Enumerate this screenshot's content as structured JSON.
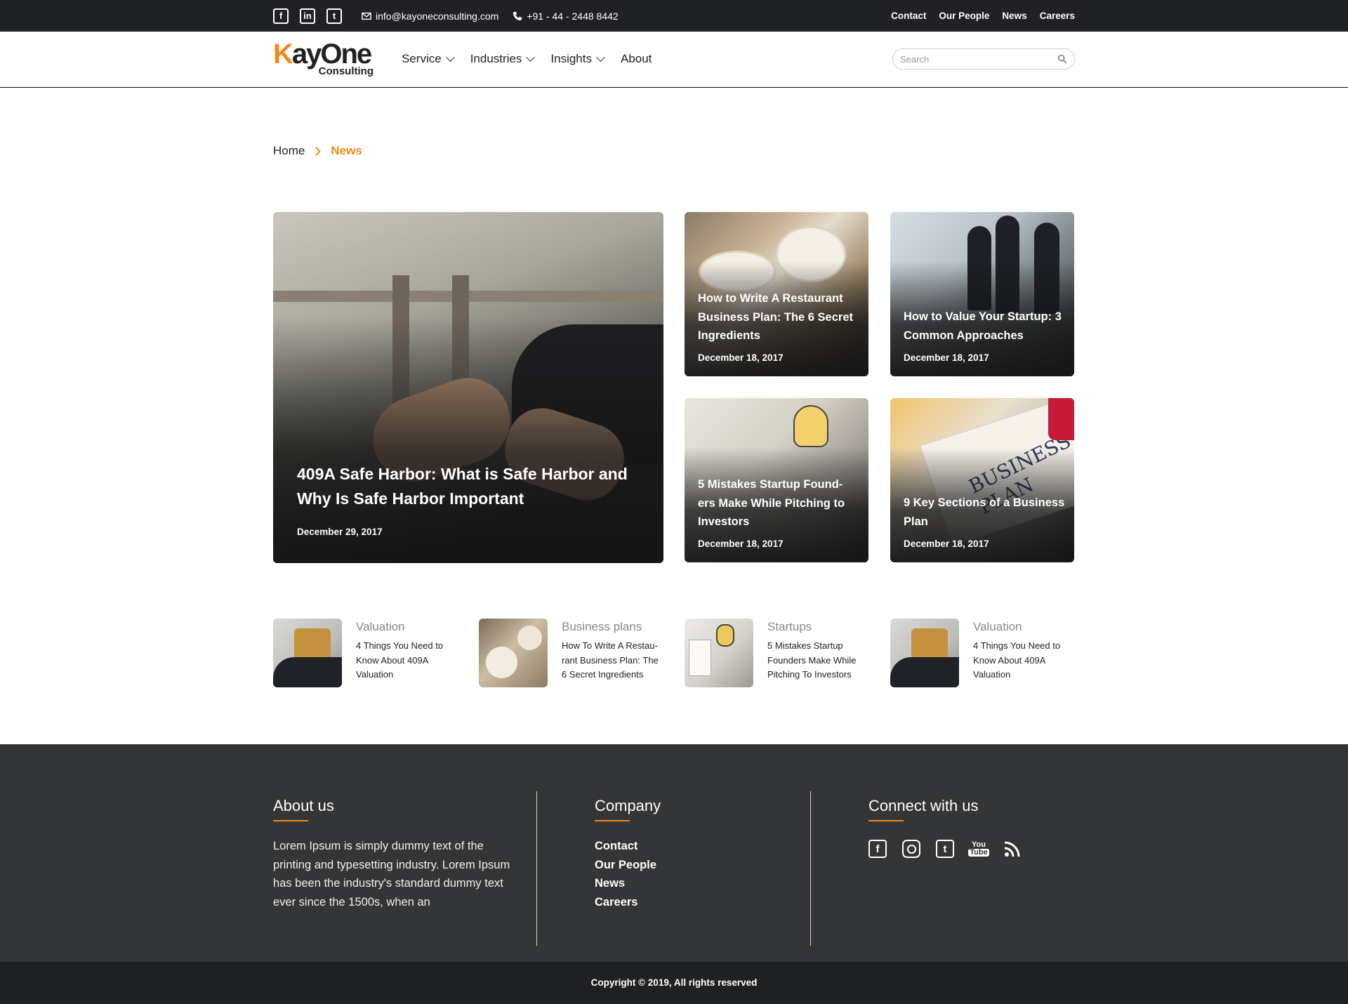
{
  "topbar": {
    "social": [
      {
        "icon": "facebook-icon",
        "glyph": "f"
      },
      {
        "icon": "linkedin-icon",
        "glyph": "in"
      },
      {
        "icon": "twitter-icon",
        "glyph": "t"
      }
    ],
    "email": "info@kayoneconsulting.com",
    "phone": "+91 - 44 - 2448 8442",
    "links": [
      "Contact",
      "Our People",
      "News",
      "Careers"
    ]
  },
  "header": {
    "logo_main": "KayOne",
    "logo_sub": "Consulting",
    "nav": [
      {
        "label": "Service",
        "dropdown": true
      },
      {
        "label": "Industries",
        "dropdown": true
      },
      {
        "label": "Insights",
        "dropdown": true
      },
      {
        "label": "About",
        "dropdown": false
      }
    ],
    "search_placeholder": "Search"
  },
  "breadcrumb": {
    "home": "Home",
    "current": "News"
  },
  "featured": {
    "title": "409A Safe Harbor: What is Safe Harbor and Why Is Safe Harbor Important",
    "date": "December 29, 2017"
  },
  "cards": [
    {
      "title": "How to Write A Restaurant Business Plan: The 6 Secret Ingredients",
      "date": "December 18, 2017"
    },
    {
      "title": "How to Value Your Startup: 3 Common Approaches",
      "date": "December 18, 2017"
    },
    {
      "title": "5 Mistakes Startup Found-ers Make While Pitching to Investors",
      "date": "December 18, 2017"
    },
    {
      "title": "9 Key Sections of a Business Plan",
      "date": "December 18, 2017"
    }
  ],
  "card_image_text": {
    "business_plan": "BUSINESS PLAN"
  },
  "mini_posts": [
    {
      "category": "Valuation",
      "title": "4 Things You Need to Know About 409A Valuation"
    },
    {
      "category": "Business plans",
      "title": "How To Write A Restau-rant Business Plan: The 6 Secret Ingredients"
    },
    {
      "category": "Startups",
      "title": "5 Mistakes Startup Founders Make While Pitching To Investors"
    },
    {
      "category": "Valuation",
      "title": "4 Things You Need to Know About 409A Valuation"
    }
  ],
  "footer": {
    "about_title": "About us",
    "about_text": "Lorem Ipsum is simply dummy text of the printing and typesetting industry. Lorem Ipsum has been the industry's standard dummy text ever since the 1500s, when an",
    "company_title": "Company",
    "company_links": [
      "Contact",
      "Our People",
      "News",
      "Careers"
    ],
    "connect_title": "Connect with us",
    "connect_icons": [
      "facebook-icon",
      "instagram-icon",
      "twitter-icon",
      "youtube-icon",
      "rss-icon"
    ],
    "copyright": "Copyright © 2019, All rights reserved"
  },
  "colors": {
    "accent": "#f28a1b",
    "topbar_bg": "#202125",
    "footer_bg": "#343536",
    "copyright_bg": "#1f2022"
  }
}
